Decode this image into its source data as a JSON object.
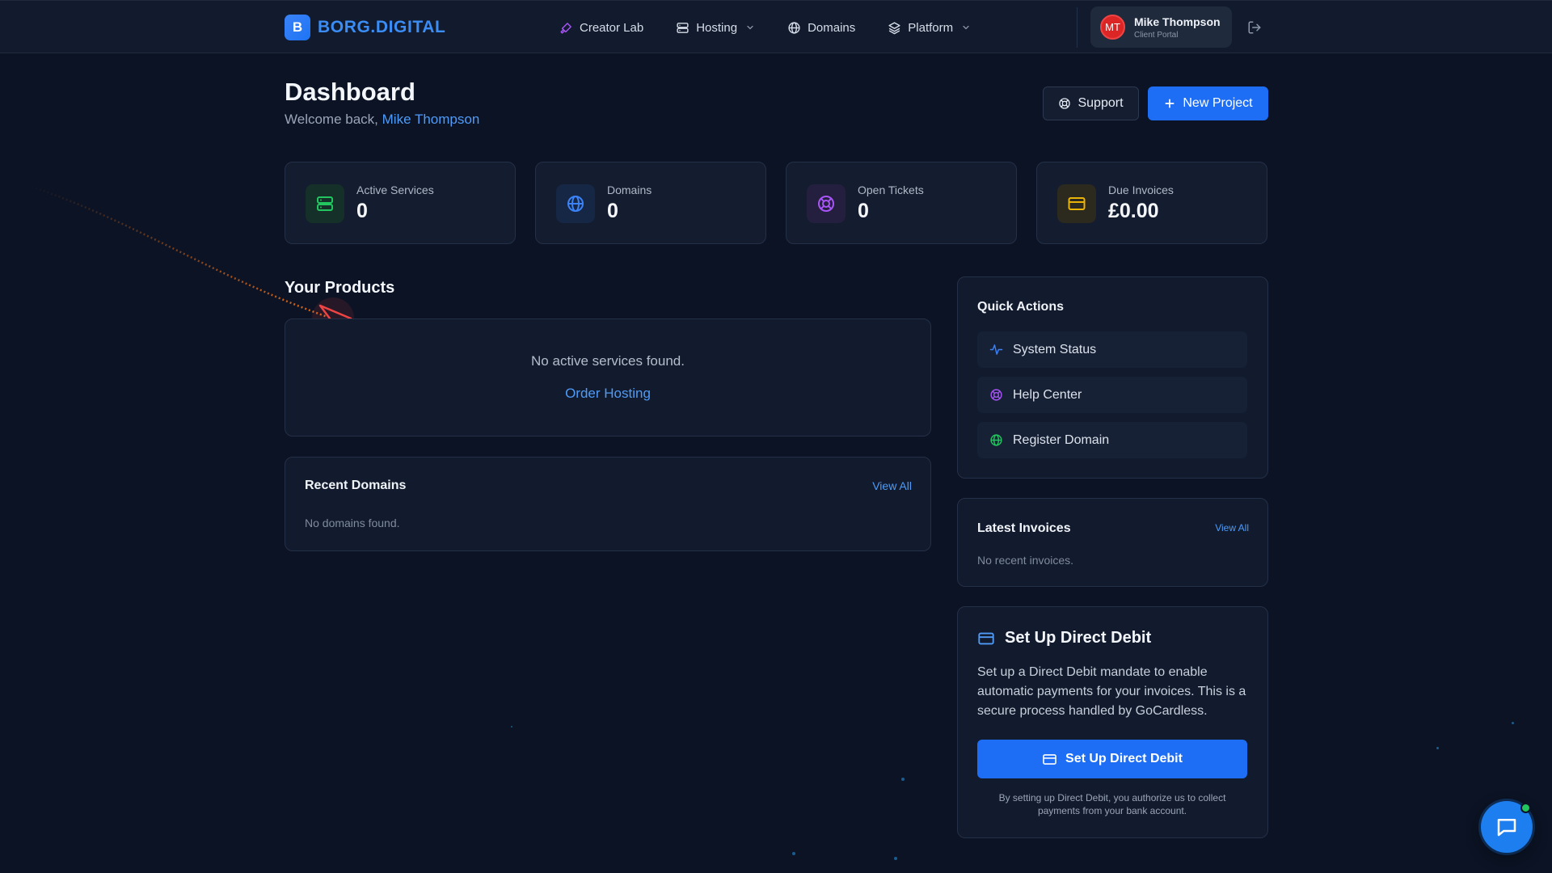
{
  "brand": {
    "mark": "B",
    "name": "BORG.DIGITAL"
  },
  "nav": {
    "items": [
      {
        "label": "Creator Lab",
        "icon": "brush-icon"
      },
      {
        "label": "Hosting",
        "icon": "server-icon",
        "dropdown": true
      },
      {
        "label": "Domains",
        "icon": "globe-icon"
      },
      {
        "label": "Platform",
        "icon": "layers-icon",
        "dropdown": true
      }
    ]
  },
  "user": {
    "initials": "MT",
    "name": "Mike Thompson",
    "subtitle": "Client Portal"
  },
  "header": {
    "title": "Dashboard",
    "welcome_prefix": "Welcome back,",
    "welcome_name": "Mike Thompson",
    "support_label": "Support",
    "new_project_label": "New Project"
  },
  "stats": [
    {
      "label": "Active Services",
      "value": "0",
      "icon": "server-icon",
      "color": "#22c55e"
    },
    {
      "label": "Domains",
      "value": "0",
      "icon": "globe-icon",
      "color": "#3b82f6"
    },
    {
      "label": "Open Tickets",
      "value": "0",
      "icon": "lifebuoy-icon",
      "color": "#a855f7"
    },
    {
      "label": "Due Invoices",
      "value": "£0.00",
      "icon": "credit-card-icon",
      "color": "#eab308"
    }
  ],
  "products": {
    "title": "Your Products",
    "empty": "No active services found.",
    "order_label": "Order Hosting"
  },
  "recent_domains": {
    "title": "Recent Domains",
    "view_all": "View All",
    "empty": "No domains found."
  },
  "quick_actions": {
    "title": "Quick Actions",
    "items": [
      {
        "label": "System Status",
        "icon": "activity-icon",
        "color": "#3b82f6"
      },
      {
        "label": "Help Center",
        "icon": "lifebuoy-icon",
        "color": "#a855f7"
      },
      {
        "label": "Register Domain",
        "icon": "globe-icon",
        "color": "#22c55e"
      }
    ]
  },
  "latest_invoices": {
    "title": "Latest Invoices",
    "view_all": "View All",
    "empty": "No recent invoices."
  },
  "direct_debit": {
    "title": "Set Up Direct Debit",
    "body": "Set up a Direct Debit mandate to enable automatic payments for your invoices. This is a secure process handled by GoCardless.",
    "button": "Set Up Direct Debit",
    "note": "By setting up Direct Debit, you authorize us to collect payments from your bank account."
  },
  "colors": {
    "accent": "#1d6ef5",
    "link": "#4f9bf7",
    "background": "#0b1324",
    "panel": "#121b2d"
  }
}
